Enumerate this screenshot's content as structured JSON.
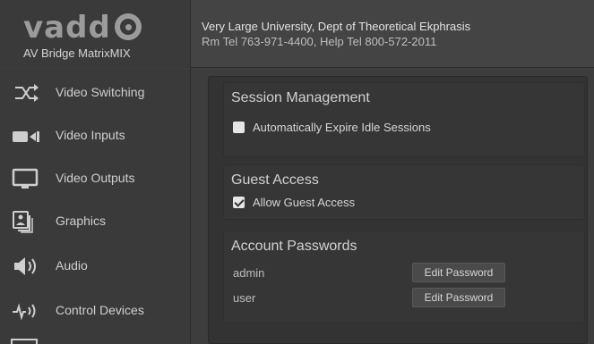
{
  "header": {
    "logo_text": "vadd",
    "product_name": "AV Bridge MatrixMIX",
    "site_name": "Very Large University, Dept of Theoretical Ekphrasis",
    "contact": "Rm Tel 763-971-4400, Help Tel 800-572-2011"
  },
  "sidebar": {
    "items": [
      {
        "label": "Video Switching",
        "icon": "video-switching-icon"
      },
      {
        "label": "Video Inputs",
        "icon": "video-inputs-icon"
      },
      {
        "label": "Video Outputs",
        "icon": "video-outputs-icon"
      },
      {
        "label": "Graphics",
        "icon": "graphics-icon"
      },
      {
        "label": "Audio",
        "icon": "audio-icon"
      },
      {
        "label": "Control Devices",
        "icon": "control-devices-icon"
      }
    ]
  },
  "session": {
    "title": "Session Management",
    "expire_label": "Automatically Expire Idle Sessions",
    "expire_checked": false
  },
  "guest": {
    "title": "Guest Access",
    "allow_label": "Allow Guest Access",
    "allow_checked": true
  },
  "accounts": {
    "title": "Account Passwords",
    "rows": [
      {
        "name": "admin",
        "button": "Edit Password"
      },
      {
        "name": "user",
        "button": "Edit Password"
      }
    ]
  },
  "colors": {
    "background": "#3d3d3d",
    "panel": "#333333",
    "text": "#d8d8d8"
  }
}
